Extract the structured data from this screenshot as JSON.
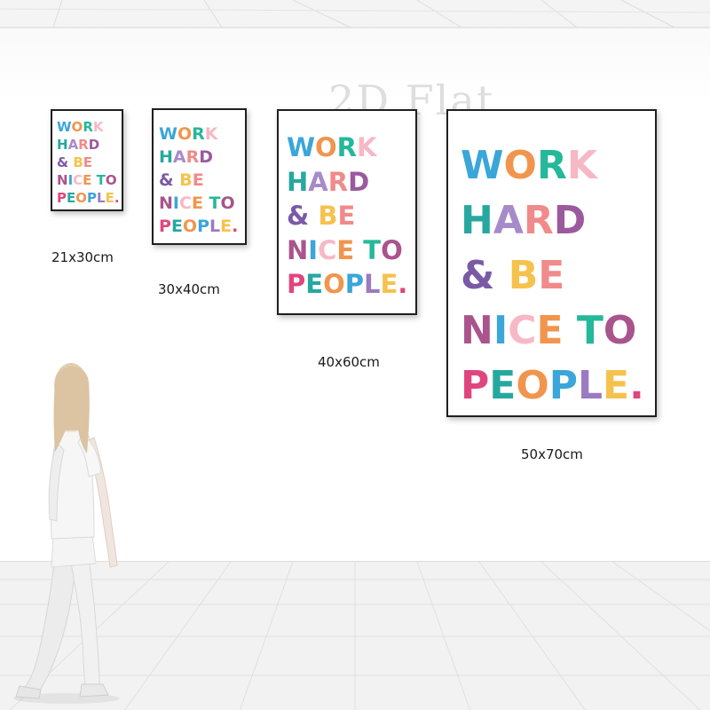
{
  "watermark": "2D Flat",
  "poster_text": {
    "line1": [
      "W",
      "O",
      "R",
      "K"
    ],
    "line2": [
      "H",
      "A",
      "R",
      "D"
    ],
    "line3": [
      "&",
      " ",
      "B",
      "E"
    ],
    "line4": [
      "N",
      "I",
      "C",
      "E",
      " ",
      "T",
      "O"
    ],
    "line5": [
      "P",
      "E",
      "O",
      "P",
      "L",
      "E",
      "."
    ]
  },
  "letter_colors": {
    "line1": [
      "#3aa6d9",
      "#f1954e",
      "#25b89a",
      "#f7b8c6"
    ],
    "line2": [
      "#26a8a0",
      "#a78bc9",
      "#f18a8a",
      "#9b5a9e"
    ],
    "line3": [
      "#7a5aa6",
      "#ffffff",
      "#f5c24d",
      "#f18a8a"
    ],
    "line4": [
      "#a9548c",
      "#3aa6d9",
      "#f7b8c6",
      "#f1954e",
      "#ffffff",
      "#25b89a",
      "#a9548c"
    ],
    "line5": [
      "#e0467e",
      "#26a8a0",
      "#f1954e",
      "#3aa6d9",
      "#9b7ac2",
      "#f5c24d",
      "#e0467e"
    ]
  },
  "sizes": [
    "21x30cm",
    "30x40cm",
    "40x60cm",
    "50x70cm"
  ]
}
